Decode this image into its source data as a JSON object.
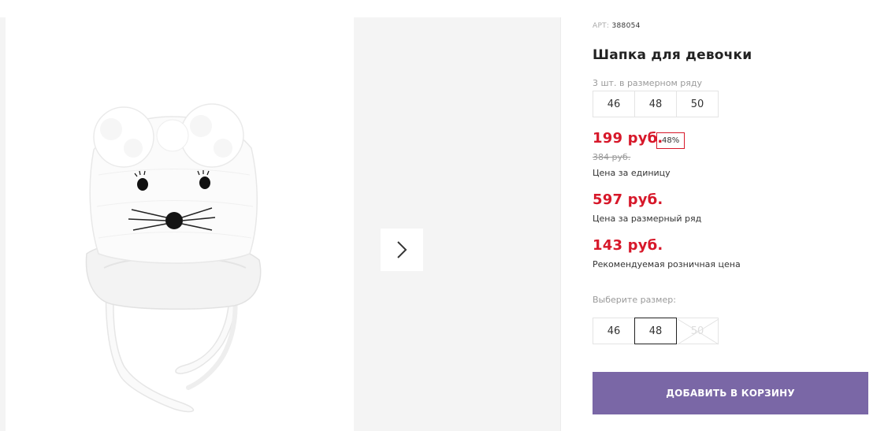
{
  "product": {
    "art_label": "АРТ:",
    "art_number": "388054",
    "title": "Шапка для девочки",
    "pack_label": "3 шт. в размерном ряду",
    "pack_sizes": [
      "46",
      "48",
      "50"
    ]
  },
  "pricing": {
    "unit_price": "199 руб.",
    "discount_badge": "48%",
    "old_price": "384 руб.",
    "unit_caption": "Цена за единицу",
    "pack_price": "597 руб.",
    "pack_caption": "Цена за размерный ряд",
    "retail_price": "143 руб.",
    "retail_caption": "Рекомендуемая розничная цена"
  },
  "size_select": {
    "label": "Выберите размер:",
    "options": [
      {
        "value": "46",
        "state": "available"
      },
      {
        "value": "48",
        "state": "selected"
      },
      {
        "value": "50",
        "state": "unavailable"
      }
    ]
  },
  "cart": {
    "button_label": "ДОБАВИТЬ В КОРЗИНУ"
  },
  "gallery": {
    "image": "white-knitted-mouse-hat-with-pompoms",
    "next_icon": "chevron-right-icon"
  },
  "colors": {
    "price_red": "#d7182a",
    "button_purple": "#7a67a6",
    "panel_gray": "#f4f4f4"
  }
}
